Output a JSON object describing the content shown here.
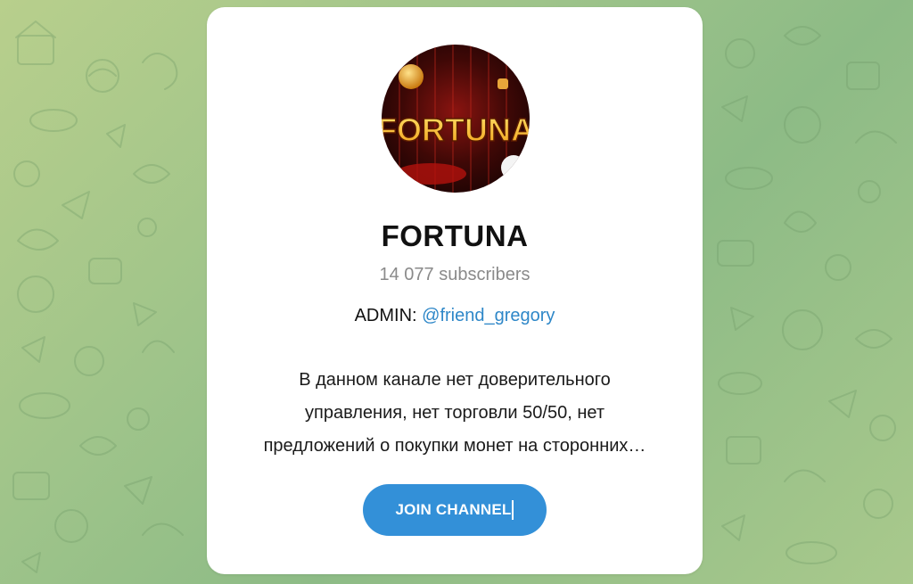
{
  "channel": {
    "name": "FORTUNA",
    "avatar_text": "FORTUNA",
    "subscribers": "14 077 subscribers",
    "admin_label": "ADMIN:",
    "admin_handle": "@friend_gregory",
    "description_lines": [
      "В данном канале нет доверительного",
      "управления, нет торговли 50/50, нет",
      "предложений о покупки монет на сторонних…"
    ]
  },
  "actions": {
    "join_label": "JOIN CHANNEL"
  },
  "colors": {
    "accent": "#3390d8",
    "link": "#2e87c8",
    "background": "#9fc48a"
  },
  "icons": {
    "avatar": "fortuna-logo"
  }
}
